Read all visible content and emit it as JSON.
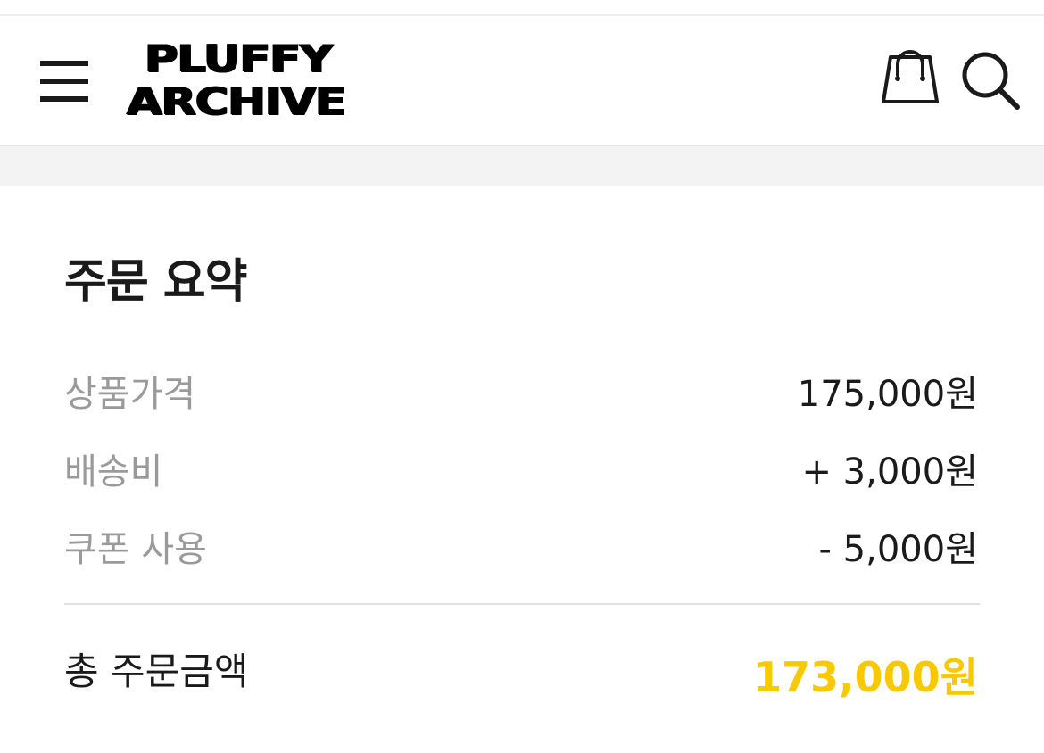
{
  "header": {
    "logo_line1": "PLUFFY",
    "logo_line2": "ARCHIVE",
    "menu_icon": "hamburger-menu-icon",
    "cart_icon": "shopping-bag-icon",
    "search_icon": "search-icon"
  },
  "summary": {
    "title": "주문 요약",
    "rows": [
      {
        "label": "상품가격",
        "value": "175,000원"
      },
      {
        "label": "배송비",
        "value": "+ 3,000원"
      },
      {
        "label": "쿠폰 사용",
        "value": "- 5,000원"
      }
    ],
    "total_label": "총 주문금액",
    "total_value": "173,000원"
  },
  "colors": {
    "accent": "#F7C900",
    "label_gray": "#9A9A9A",
    "text": "#1A1A1A",
    "band": "#F3F3F3"
  }
}
